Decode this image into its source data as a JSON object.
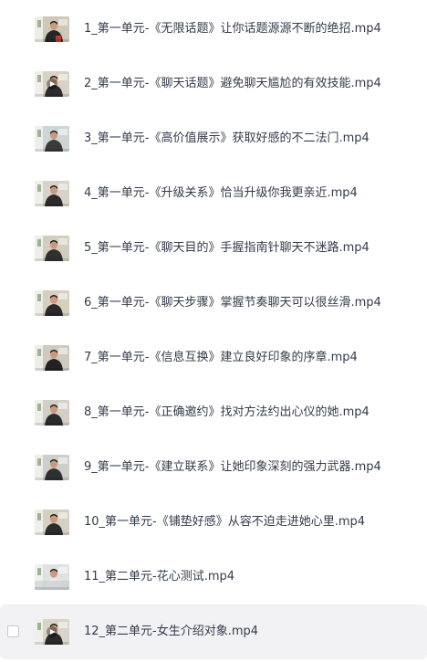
{
  "files": [
    {
      "name": "1_第一单元-《无限话题》让你话题源源不断的绝招.mp4",
      "thumb_icon": "video-thumbnail-icon"
    },
    {
      "name": "2_第一单元-《聊天话题》避免聊天尴尬的有效技能.mp4",
      "thumb_icon": "video-thumbnail-icon"
    },
    {
      "name": "3_第一单元-《高价值展示》获取好感的不二法门.mp4",
      "thumb_icon": "video-thumbnail-icon"
    },
    {
      "name": "4_第一单元-《升级关系》恰当升级你我更亲近.mp4",
      "thumb_icon": "video-thumbnail-icon"
    },
    {
      "name": "5_第一单元-《聊天目的》手握指南针聊天不迷路.mp4",
      "thumb_icon": "video-thumbnail-icon"
    },
    {
      "name": "6_第一单元-《聊天步骤》掌握节奏聊天可以很丝滑.mp4",
      "thumb_icon": "video-thumbnail-icon"
    },
    {
      "name": "7_第一单元-《信息互换》建立良好印象的序章.mp4",
      "thumb_icon": "video-thumbnail-icon"
    },
    {
      "name": "8_第一单元-《正确邀约》找对方法约出心仪的她.mp4",
      "thumb_icon": "video-thumbnail-icon"
    },
    {
      "name": "9_第一单元-《建立联系》让她印象深刻的强力武器.mp4",
      "thumb_icon": "video-thumbnail-icon"
    },
    {
      "name": "10_第一单元-《铺垫好感》从容不迫走进她心里.mp4",
      "thumb_icon": "video-thumbnail-icon"
    },
    {
      "name": "11_第二单元-花心测试.mp4",
      "thumb_icon": "video-thumbnail-icon"
    },
    {
      "name": "12_第二单元-女生介绍对象.mp4",
      "thumb_icon": "video-thumbnail-icon"
    }
  ],
  "hovered_index": 11,
  "colors": {
    "text": "#333b4a",
    "hover_bg": "#f2f2f4",
    "checkbox_border": "#c8c8cc"
  }
}
